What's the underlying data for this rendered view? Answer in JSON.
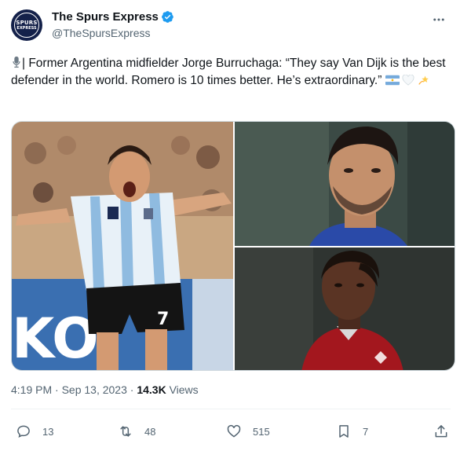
{
  "author": {
    "display_name": "The Spurs Express",
    "handle": "@TheSpursExpress",
    "avatar_text_top": "SPURS",
    "avatar_text_bottom": "EXPRESS",
    "verified": true
  },
  "tweet": {
    "text_before": "| Former Argentina midfielder Jorge Burruchaga: “They say Van Dijk is the best defender in the world. Romero is 10 times better. He’s extraordinary.”",
    "icons": [
      "microphone-icon",
      "argentina-flag-icon",
      "white-heart-icon",
      "dizzy-star-icon"
    ]
  },
  "media": {
    "photos": [
      "Burruchaga in Argentina kit celebrating",
      "Romero portrait",
      "Van Dijk portrait in red kit"
    ]
  },
  "meta": {
    "time": "4:19 PM · Sep 13, 2023 · ",
    "views_count": "14.3K",
    "views_label": " Views"
  },
  "actions": {
    "replies": "13",
    "retweets": "48",
    "likes": "515",
    "bookmarks": "7"
  },
  "colors": {
    "text": "#0f1419",
    "muted": "#536471",
    "verified": "#1d9bf0",
    "avatar_bg": "#14214a"
  }
}
